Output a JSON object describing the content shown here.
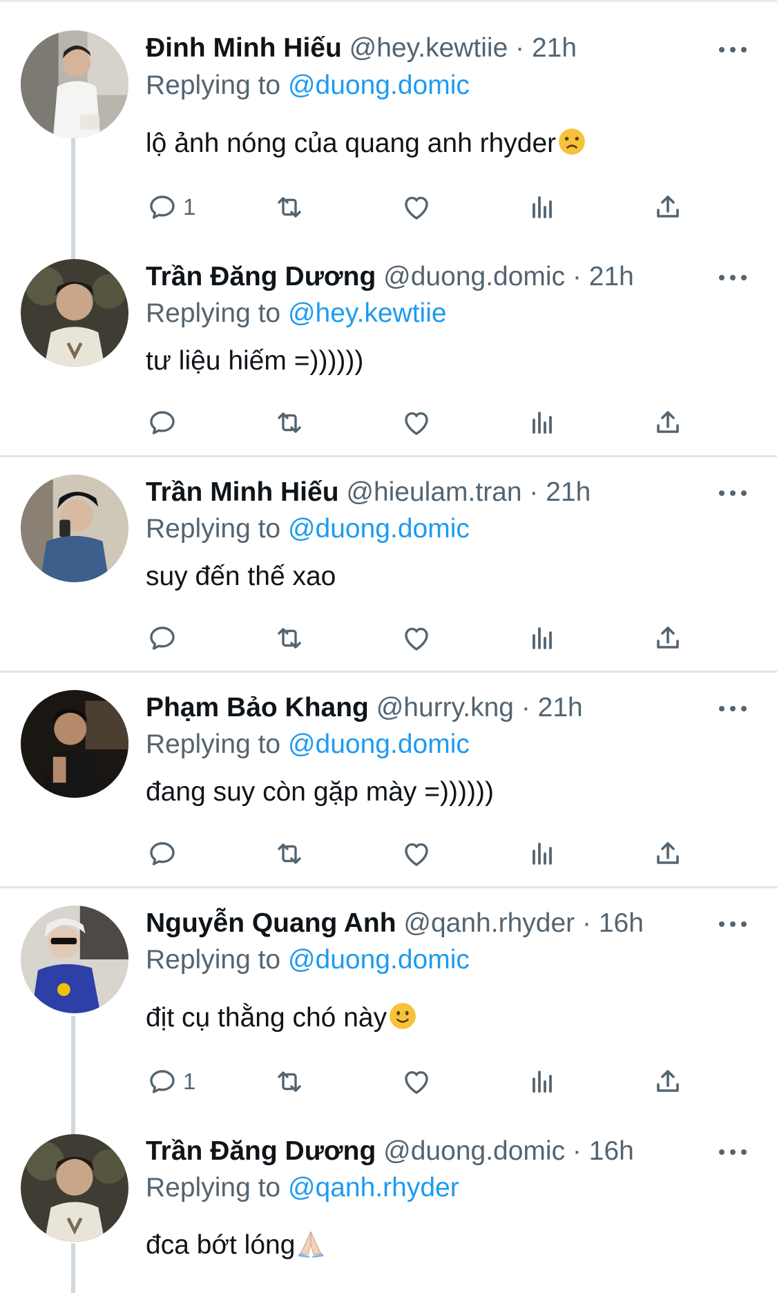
{
  "tweets": [
    {
      "name": "Đinh Minh Hiếu",
      "handle": "@hey.kewtiie",
      "sep": "·",
      "time": "21h",
      "replying_prefix": "Replying to ",
      "replying_to": "@duong.domic",
      "text": "lộ ảnh nóng của quang anh rhyder",
      "emoji": "frowning-face",
      "reply_count": "1"
    },
    {
      "name": "Trần Đăng Dương",
      "handle": "@duong.domic",
      "sep": "·",
      "time": "21h",
      "replying_prefix": "Replying to ",
      "replying_to": "@hey.kewtiie",
      "text": "tư liệu hiếm =))))))",
      "reply_count": ""
    },
    {
      "name": "Trần Minh Hiếu",
      "handle": "@hieulam.tran",
      "sep": "·",
      "time": "21h",
      "replying_prefix": "Replying to ",
      "replying_to": "@duong.domic",
      "text": "suy đến thế xao",
      "reply_count": ""
    },
    {
      "name": "Phạm Bảo Khang",
      "handle": "@hurry.kng",
      "sep": "·",
      "time": "21h",
      "replying_prefix": "Replying to ",
      "replying_to": "@duong.domic",
      "text": "đang suy còn gặp mày =))))))",
      "reply_count": ""
    },
    {
      "name": "Nguyễn Quang Anh",
      "handle": "@qanh.rhyder",
      "sep": "·",
      "time": "16h",
      "replying_prefix": "Replying to ",
      "replying_to": "@duong.domic",
      "text": "địt cụ thằng chó này",
      "emoji": "slightly-smiling-face",
      "reply_count": "1"
    },
    {
      "name": "Trần Đăng Dương",
      "handle": "@duong.domic",
      "sep": "·",
      "time": "16h",
      "replying_prefix": "Replying to ",
      "replying_to": "@qanh.rhyder",
      "text": "đca bớt lóng",
      "emoji": "folded-hands"
    }
  ],
  "icons": {
    "reply": "reply-icon",
    "retweet": "retweet-icon",
    "like": "heart-icon",
    "views": "analytics-icon",
    "share": "share-icon",
    "more": "more-icon"
  },
  "colors": {
    "accent": "#1d9bf0",
    "muted": "#536471",
    "text": "#0f1419",
    "divider": "#e1e4e6",
    "thread_line": "#cfd9de"
  }
}
